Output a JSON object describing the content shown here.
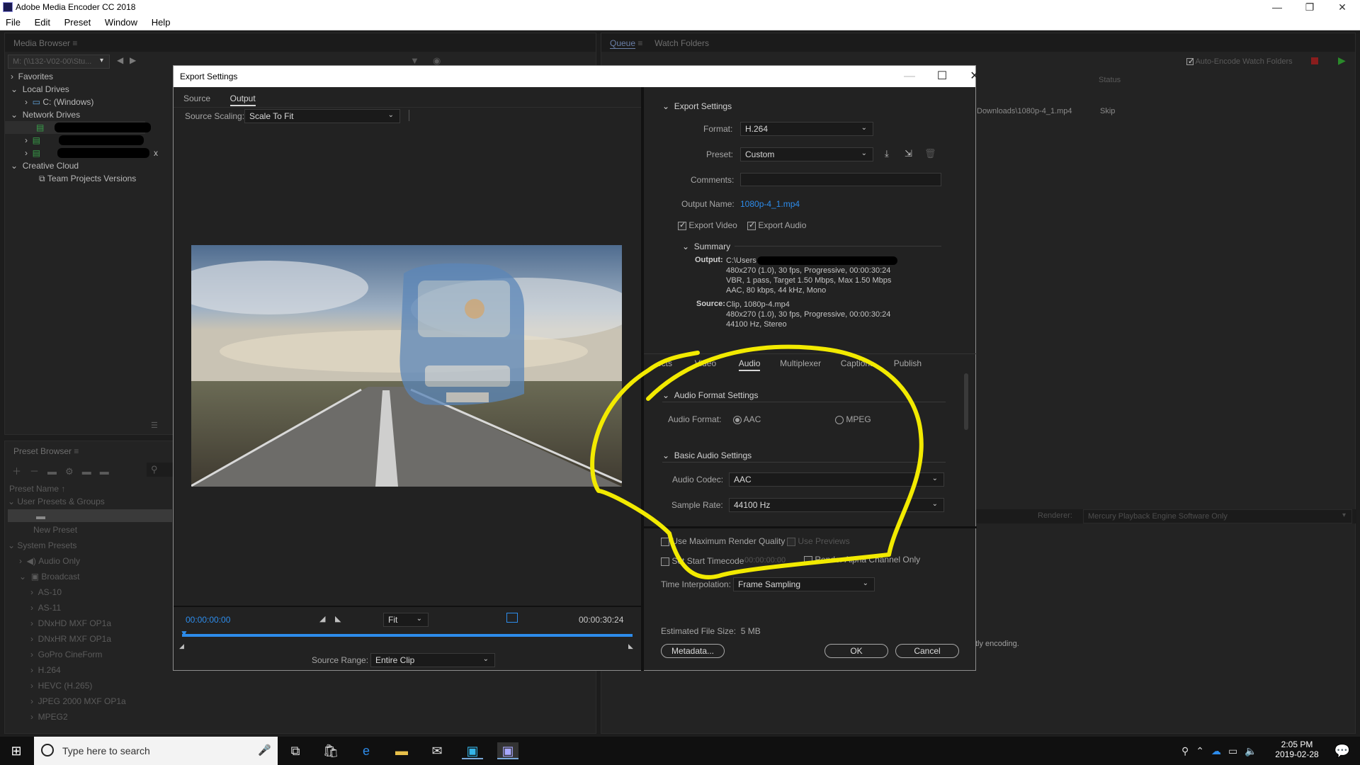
{
  "app": {
    "title": "Adobe Media Encoder CC 2018",
    "menu": [
      "File",
      "Edit",
      "Preset",
      "Window",
      "Help"
    ],
    "window_controls": {
      "minimize": "—",
      "restore": "❐",
      "close": "✕"
    }
  },
  "media_browser": {
    "header": "Media Browser",
    "path": "M: (\\\\132-V02-00\\Stu...",
    "tree": [
      {
        "label": "Favorites",
        "indent": 0
      },
      {
        "label": "Local Drives",
        "indent": 0
      },
      {
        "label": "C: (Windows)",
        "indent": 2
      },
      {
        "label": "Network Drives",
        "indent": 0
      },
      {
        "label": "Creative Cloud",
        "indent": 0
      },
      {
        "label": "Team Projects Versions",
        "indent": 2
      }
    ],
    "network_x": "x"
  },
  "preset_browser": {
    "header": "Preset Browser",
    "col_header": "Preset Name",
    "user_group": "User Presets & Groups",
    "new_preset": "New Preset",
    "system_presets": "System Presets",
    "items": [
      "Audio Only",
      "Broadcast",
      "AS-10",
      "AS-11",
      "DNxHD MXF OP1a",
      "DNxHR MXF OP1a",
      "GoPro CineForm",
      "H.264",
      "HEVC (H.265)",
      "JPEG 2000 MXF OP1a",
      "MPEG2"
    ]
  },
  "queue": {
    "tabs": [
      "Queue",
      "Watch Folders"
    ],
    "auto_encode": "Auto-Encode Watch Folders",
    "status_col": "Status",
    "row_path": "Downloads\\1080p-4_1.mp4",
    "row_status": "Skip",
    "renderer_label": "Renderer:",
    "renderer_value": "Mercury Playback Engine Software Only",
    "encoding_text": "tly encoding."
  },
  "dialog": {
    "title": "Export Settings",
    "tabs": [
      "Source",
      "Output"
    ],
    "source_scaling_label": "Source Scaling:",
    "source_scaling_value": "Scale To Fit",
    "timecode_start": "00:00:00:00",
    "timecode_end": "00:00:30:24",
    "zoom": "Fit",
    "source_range_label": "Source Range:",
    "source_range_value": "Entire Clip",
    "export_settings_header": "Export Settings",
    "format_label": "Format:",
    "format_value": "H.264",
    "preset_label": "Preset:",
    "preset_value": "Custom",
    "comments_label": "Comments:",
    "output_name_label": "Output Name:",
    "output_name_value": "1080p-4_1.mp4",
    "export_video": "Export Video",
    "export_audio": "Export Audio",
    "summary_header": "Summary",
    "summary_output_label": "Output:",
    "summary_output_lines": [
      "C:\\Users",
      "480x270 (1.0), 30 fps, Progressive, 00:00:30:24",
      "VBR, 1 pass, Target 1.50 Mbps, Max 1.50 Mbps",
      "AAC, 80 kbps, 44 kHz, Mono"
    ],
    "summary_source_label": "Source:",
    "summary_source_lines": [
      "Clip, 1080p-4.mp4",
      "480x270 (1.0), 30 fps, Progressive, 00:00:30:24",
      "44100 Hz, Stereo"
    ],
    "settings_tabs": [
      "ects",
      "Video",
      "Audio",
      "Multiplexer",
      "Captions",
      "Publish"
    ],
    "active_settings_tab": "Audio",
    "audio_format_header": "Audio Format Settings",
    "audio_format_label": "Audio Format:",
    "audio_format_aac": "AAC",
    "audio_format_mpeg": "MPEG",
    "basic_audio_header": "Basic Audio Settings",
    "audio_codec_label": "Audio Codec:",
    "audio_codec_value": "AAC",
    "sample_rate_label": "Sample Rate:",
    "sample_rate_value": "44100 Hz",
    "max_render_quality": "Use Maximum Render Quality",
    "use_previews": "Use Previews",
    "set_start_timecode": "Set Start Timecode",
    "start_timecode_value": "00:00:00:00",
    "render_alpha": "Render Alpha Channel Only",
    "time_interp_label": "Time Interpolation:",
    "time_interp_value": "Frame Sampling",
    "file_size_label": "Estimated File Size:",
    "file_size_value": "5 MB",
    "metadata_btn": "Metadata...",
    "ok_btn": "OK",
    "cancel_btn": "Cancel"
  },
  "taskbar": {
    "search_placeholder": "Type here to search",
    "time": "2:05 PM",
    "date": "2019-02-28"
  },
  "colors": {
    "accent_blue": "#2d8ceb",
    "annotation_yellow": "#f2ea00"
  }
}
